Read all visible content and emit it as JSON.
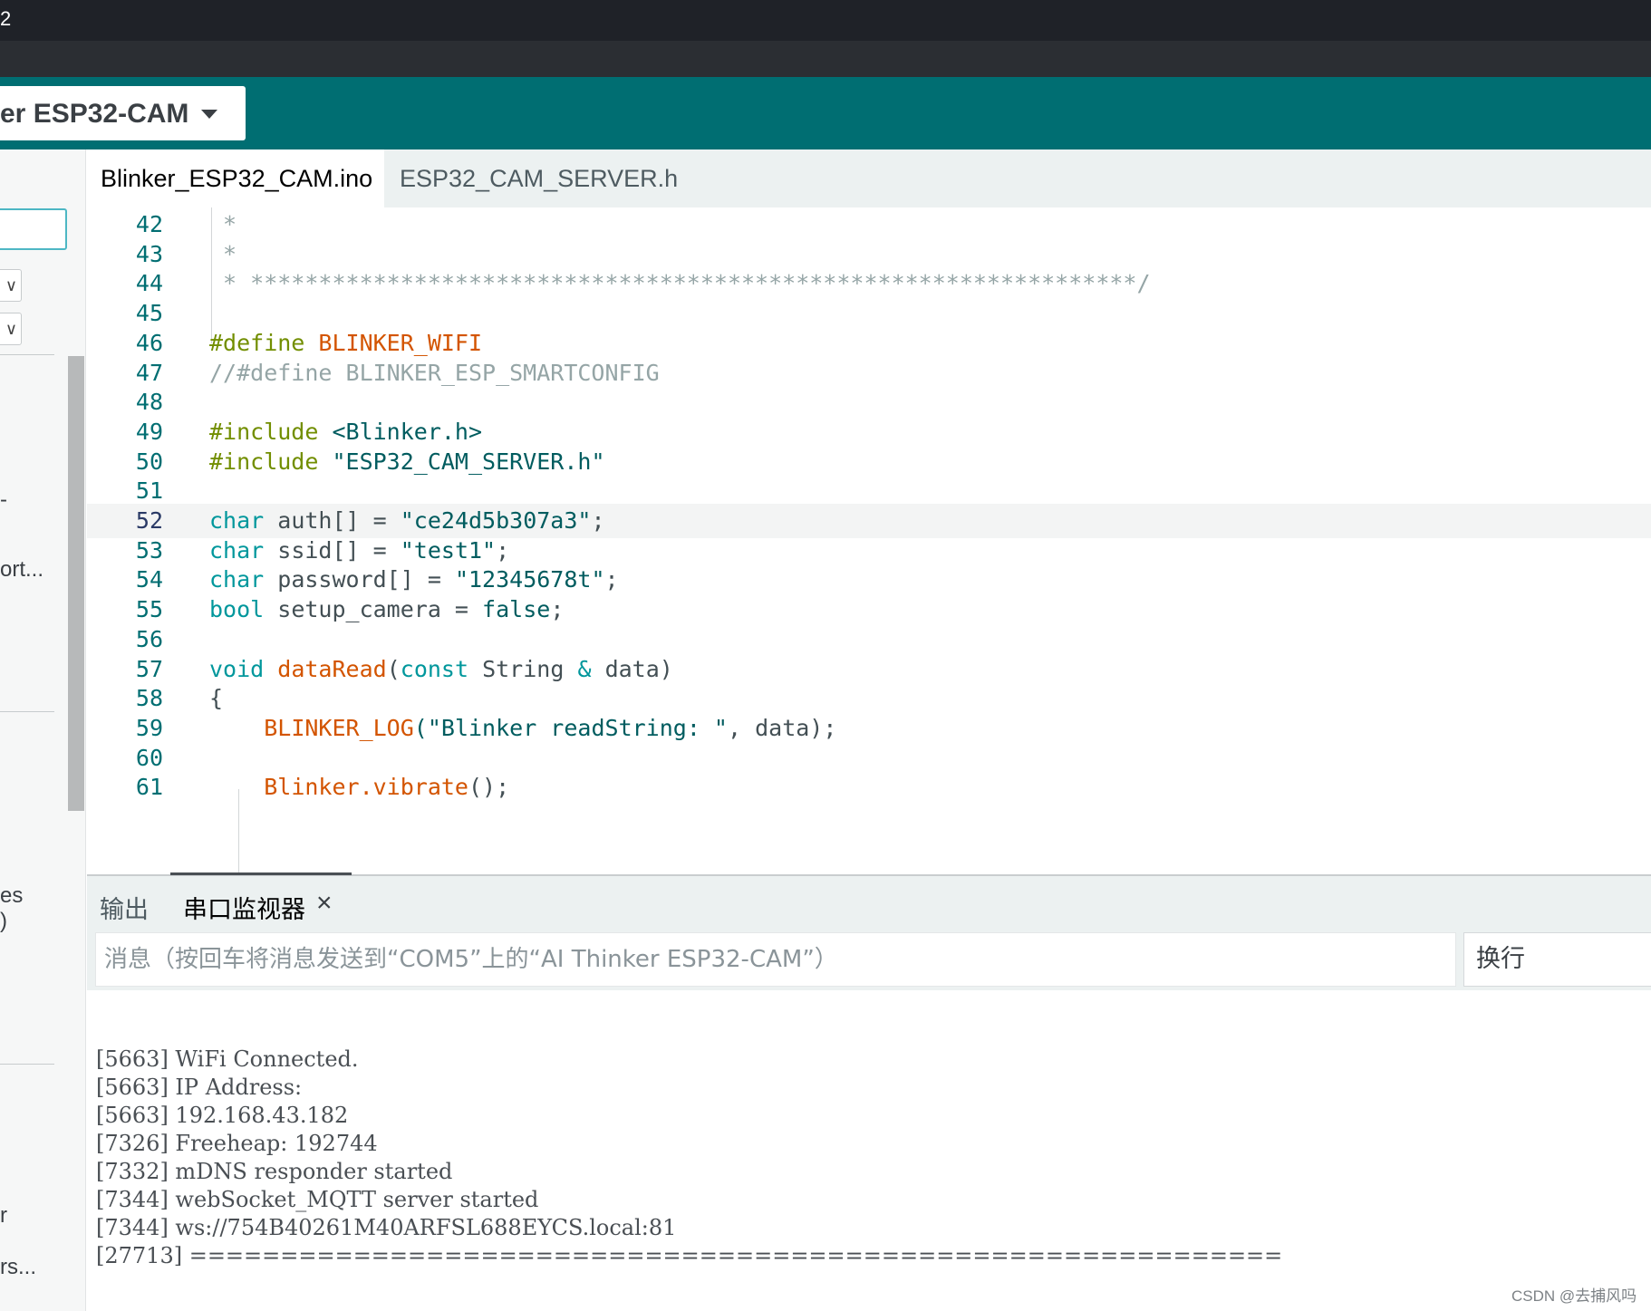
{
  "window": {
    "title_fragment": "2"
  },
  "toolbar": {
    "board_name": "er ESP32-CAM"
  },
  "sidebar": {
    "texts": [
      "-",
      "ort...",
      "es",
      ")",
      "r",
      "rs..."
    ]
  },
  "editor": {
    "tabs": [
      {
        "label": "Blinker_ESP32_CAM.ino",
        "active": true
      },
      {
        "label": "ESP32_CAM_SERVER.h",
        "active": false
      }
    ],
    "current_line": 52,
    "lines": [
      {
        "n": "42",
        "t": [
          {
            "c": "cm",
            "s": " *"
          }
        ]
      },
      {
        "n": "43",
        "t": [
          {
            "c": "cm",
            "s": " *"
          }
        ]
      },
      {
        "n": "44",
        "t": [
          {
            "c": "cm",
            "s": " * *****************************************************************/"
          }
        ]
      },
      {
        "n": "45",
        "t": []
      },
      {
        "n": "46",
        "t": [
          {
            "c": "pp",
            "s": "#define "
          },
          {
            "c": "fn",
            "s": "BLINKER_WIFI"
          }
        ]
      },
      {
        "n": "47",
        "t": [
          {
            "c": "cm",
            "s": "//#define BLINKER_ESP_SMARTCONFIG"
          }
        ]
      },
      {
        "n": "48",
        "t": []
      },
      {
        "n": "49",
        "t": [
          {
            "c": "pp",
            "s": "#include "
          },
          {
            "c": "str",
            "s": "<Blinker.h>"
          }
        ]
      },
      {
        "n": "50",
        "t": [
          {
            "c": "pp",
            "s": "#include "
          },
          {
            "c": "str",
            "s": "\"ESP32_CAM_SERVER.h\""
          }
        ]
      },
      {
        "n": "51",
        "t": []
      },
      {
        "n": "52",
        "t": [
          {
            "c": "kw",
            "s": "char"
          },
          {
            "c": "tx",
            "s": " auth[] = "
          },
          {
            "c": "str",
            "s": "\"ce24d5b307a3\""
          },
          {
            "c": "tx",
            "s": ";"
          }
        ]
      },
      {
        "n": "53",
        "t": [
          {
            "c": "kw",
            "s": "char"
          },
          {
            "c": "tx",
            "s": " ssid[] = "
          },
          {
            "c": "str",
            "s": "\"test1\""
          },
          {
            "c": "tx",
            "s": ";"
          }
        ]
      },
      {
        "n": "54",
        "t": [
          {
            "c": "kw",
            "s": "char"
          },
          {
            "c": "tx",
            "s": " password[] = "
          },
          {
            "c": "str",
            "s": "\"12345678t\""
          },
          {
            "c": "tx",
            "s": ";"
          }
        ]
      },
      {
        "n": "55",
        "t": [
          {
            "c": "kw",
            "s": "bool"
          },
          {
            "c": "tx",
            "s": " setup_camera = "
          },
          {
            "c": "str",
            "s": "false"
          },
          {
            "c": "tx",
            "s": ";"
          }
        ]
      },
      {
        "n": "56",
        "t": []
      },
      {
        "n": "57",
        "t": [
          {
            "c": "kw",
            "s": "void"
          },
          {
            "c": "tx",
            "s": " "
          },
          {
            "c": "fn",
            "s": "dataRead"
          },
          {
            "c": "tx",
            "s": "("
          },
          {
            "c": "kw",
            "s": "const"
          },
          {
            "c": "tx",
            "s": " String "
          },
          {
            "c": "kw",
            "s": "&"
          },
          {
            "c": "tx",
            "s": " data)"
          }
        ]
      },
      {
        "n": "58",
        "t": [
          {
            "c": "tx",
            "s": "{"
          }
        ]
      },
      {
        "n": "59",
        "t": [
          {
            "c": "tx",
            "s": "    "
          },
          {
            "c": "fn",
            "s": "BLINKER_LOG"
          },
          {
            "c": "str",
            "s": "(\"Blinker readString: \""
          },
          {
            "c": "tx",
            "s": ", data);"
          }
        ]
      },
      {
        "n": "60",
        "t": []
      },
      {
        "n": "61",
        "t": [
          {
            "c": "tx",
            "s": "    "
          },
          {
            "c": "fn",
            "s": "Blinker.vibrate"
          },
          {
            "c": "tx",
            "s": "();"
          }
        ]
      }
    ]
  },
  "bottom_panel": {
    "tab_output": "输出",
    "tab_serial": "串口监视器",
    "close_glyph": "×",
    "message_placeholder": "消息（按回车将消息发送到“COM5”上的“AI Thinker ESP32-CAM”）",
    "line_ending": "换行",
    "serial_lines": [
      "[5663] WiFi Connected.",
      "[5663] IP Address:",
      "[5663] 192.168.43.182",
      "[7326] Freeheap: 192744",
      "[7332] mDNS responder started",
      "[7344] webSocket_MQTT server started",
      "[7344] ws://754B40261M40ARFSL688EYCS.local:81",
      "[27713] ============================================================"
    ]
  },
  "watermark": "CSDN @去捕风吗"
}
